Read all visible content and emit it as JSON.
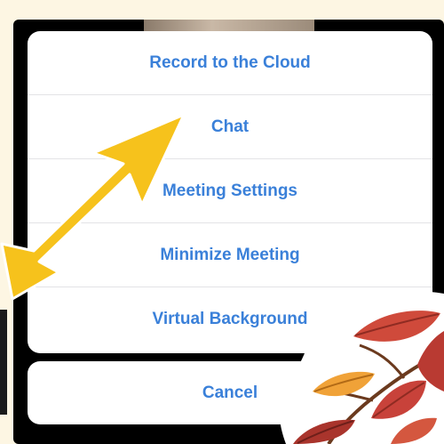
{
  "action_sheet": {
    "items": [
      {
        "label": "Record to the Cloud"
      },
      {
        "label": "Chat"
      },
      {
        "label": "Meeting Settings"
      },
      {
        "label": "Minimize Meeting"
      },
      {
        "label": "Virtual Background"
      }
    ],
    "cancel_label": "Cancel"
  },
  "colors": {
    "accent_text": "#3a80d9",
    "arrow": "#f6c21c",
    "background": "#fdf6e3"
  },
  "decorations": {
    "arrow_icon": "double-headed-arrow-icon",
    "leaves_icon": "autumn-leaves-icon"
  }
}
